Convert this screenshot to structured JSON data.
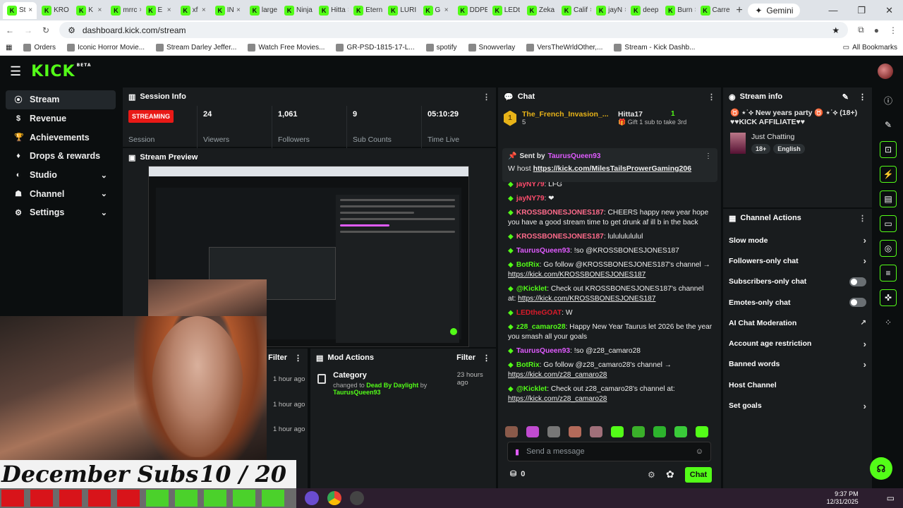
{
  "browser": {
    "tabs": [
      "St",
      "KRO",
      "K",
      "mrrc",
      "E",
      "xf",
      "IN",
      "large",
      "Ninja",
      "Hitta",
      "Etern",
      "LURI",
      "G",
      "DDPE",
      "LEDt",
      "Zeka",
      "Calif",
      "jayN",
      "deep",
      "Burn",
      "Carre"
    ],
    "gemini_label": "Gemini",
    "url": "dashboard.kick.com/stream",
    "bookmarks": [
      "Orders",
      "Iconic Horror Movie...",
      "Stream Darley Jeffer...",
      "Watch Free Movies...",
      "GR-PSD-1815-17-L...",
      "spotify",
      "Snowverlay",
      "VersTheWrldOther,...",
      "Stream - Kick Dashb..."
    ],
    "all_bookmarks": "All Bookmarks"
  },
  "kick": {
    "logo": "KICK",
    "beta": "BETA"
  },
  "sidebar": {
    "items": [
      {
        "label": "Stream",
        "icon": "stream-icon"
      },
      {
        "label": "Revenue",
        "icon": "dollar-icon"
      },
      {
        "label": "Achievements",
        "icon": "trophy-icon"
      },
      {
        "label": "Drops & rewards",
        "icon": "gift-icon"
      },
      {
        "label": "Studio",
        "icon": "studio-icon"
      },
      {
        "label": "Channel",
        "icon": "channel-icon"
      },
      {
        "label": "Settings",
        "icon": "gear-icon"
      }
    ]
  },
  "session": {
    "title": "Session Info",
    "status": "STREAMING",
    "status_label": "Session",
    "viewers": "24",
    "viewers_label": "Viewers",
    "followers": "1,061",
    "followers_label": "Followers",
    "subs": "9",
    "subs_label": "Sub Counts",
    "time": "05:10:29",
    "time_label": "Time Live"
  },
  "preview": {
    "title": "Stream Preview"
  },
  "overlay": {
    "subs_label": "December Subs",
    "subs_count": "10 / 20"
  },
  "lower": {
    "filter": "Filter",
    "times": [
      "1 hour ago",
      "1 hour ago",
      "1 hour ago"
    ],
    "mod_title": "Mod Actions",
    "mod_filter": "Filter",
    "mod_item_title": "Category",
    "mod_item_prefix": "changed to",
    "mod_item_game": "Dead By Daylight",
    "mod_item_by": "by",
    "mod_item_user": "TaurusQueen93",
    "mod_item_time": "23 hours ago"
  },
  "chat": {
    "title": "Chat",
    "top_user": "The_French_Invasion_...",
    "top_count": "5",
    "top_user2": "Hitta17",
    "top_count2": "1",
    "gift_text": "Gift 1 sub to take 3rd",
    "pinned_by_label": "Sent by",
    "pinned_user": "TaurusQueen93",
    "pinned_text": "W host",
    "pinned_link": "https://kick.com/MilesTailsProwerGaming206",
    "messages": [
      {
        "user": "jayNY79",
        "color": "#ff4d6d",
        "text": ": LFG"
      },
      {
        "user": "jayNY79",
        "color": "#ff4d6d",
        "text": ": ❤"
      },
      {
        "user": "KROSSBONESJONES187",
        "color": "#ff6b8b",
        "text": ": CHEERS happy new year hope you have a good stream time to get drunk af ill b in the back"
      },
      {
        "user": "KROSSBONESJONES187",
        "color": "#ff6b8b",
        "text": ": lulululululul"
      },
      {
        "user": "TaurusQueen93",
        "color": "#e05bff",
        "text": ": !so @KROSSBONESJONES187"
      },
      {
        "user": "BotRix",
        "color": "#53fc18",
        "text": ": Go follow @KROSSBONESJONES187's channel → ",
        "link": "https://kick.com/KROSSBONESJONES187"
      },
      {
        "user": "@Kicklet",
        "color": "#53fc18",
        "text": ": Check out KROSSBONESJONES187's channel at: ",
        "link": "https://kick.com/KROSSBONESJONES187"
      },
      {
        "user": "LEDtheGOAT",
        "color": "#d81b2a",
        "text": ": W"
      },
      {
        "user": "z28_camaro28",
        "color": "#53fc18",
        "text": ": Happy New Year Taurus let 2026 be the year you smash all your goals"
      },
      {
        "user": "TaurusQueen93",
        "color": "#e05bff",
        "text": ": !so @z28_camaro28"
      },
      {
        "user": "BotRix",
        "color": "#53fc18",
        "text": ": Go follow @z28_camaro28's channel → ",
        "link": "https://kick.com/z28_camaro28"
      },
      {
        "user": "@Kicklet",
        "color": "#53fc18",
        "text": ": Check out z28_camaro28's channel at: ",
        "link": "https://kick.com/z28_camaro28"
      }
    ],
    "placeholder": "Send a message",
    "points": "0",
    "send": "Chat"
  },
  "stream_info": {
    "title": "Stream info",
    "stream_title": "♉ ⋆˙⟡ New years party ♉ ⋆˙⟡ (18+) ♥♥KICK AFFILIATE♥♥",
    "category": "Just Chatting",
    "tags": [
      "18+",
      "English"
    ]
  },
  "channel_actions": {
    "title": "Channel Actions",
    "items": [
      {
        "label": "Slow mode",
        "kind": "arrow"
      },
      {
        "label": "Followers-only chat",
        "kind": "arrow"
      },
      {
        "label": "Subscribers-only chat",
        "kind": "toggle"
      },
      {
        "label": "Emotes-only chat",
        "kind": "toggle"
      },
      {
        "label": "AI Chat Moderation",
        "kind": "external"
      },
      {
        "label": "Account age restriction",
        "kind": "arrow"
      },
      {
        "label": "Banned words",
        "kind": "arrow"
      },
      {
        "label": "Host Channel",
        "kind": "none"
      },
      {
        "label": "Set goals",
        "kind": "arrow"
      }
    ]
  },
  "taskbar": {
    "time": "9:37 PM",
    "date": "12/31/2025"
  },
  "colors": {
    "accent": "#53fc18",
    "live": "#e91916",
    "panel": "#191c1e",
    "bg": "#0b0e0f"
  }
}
